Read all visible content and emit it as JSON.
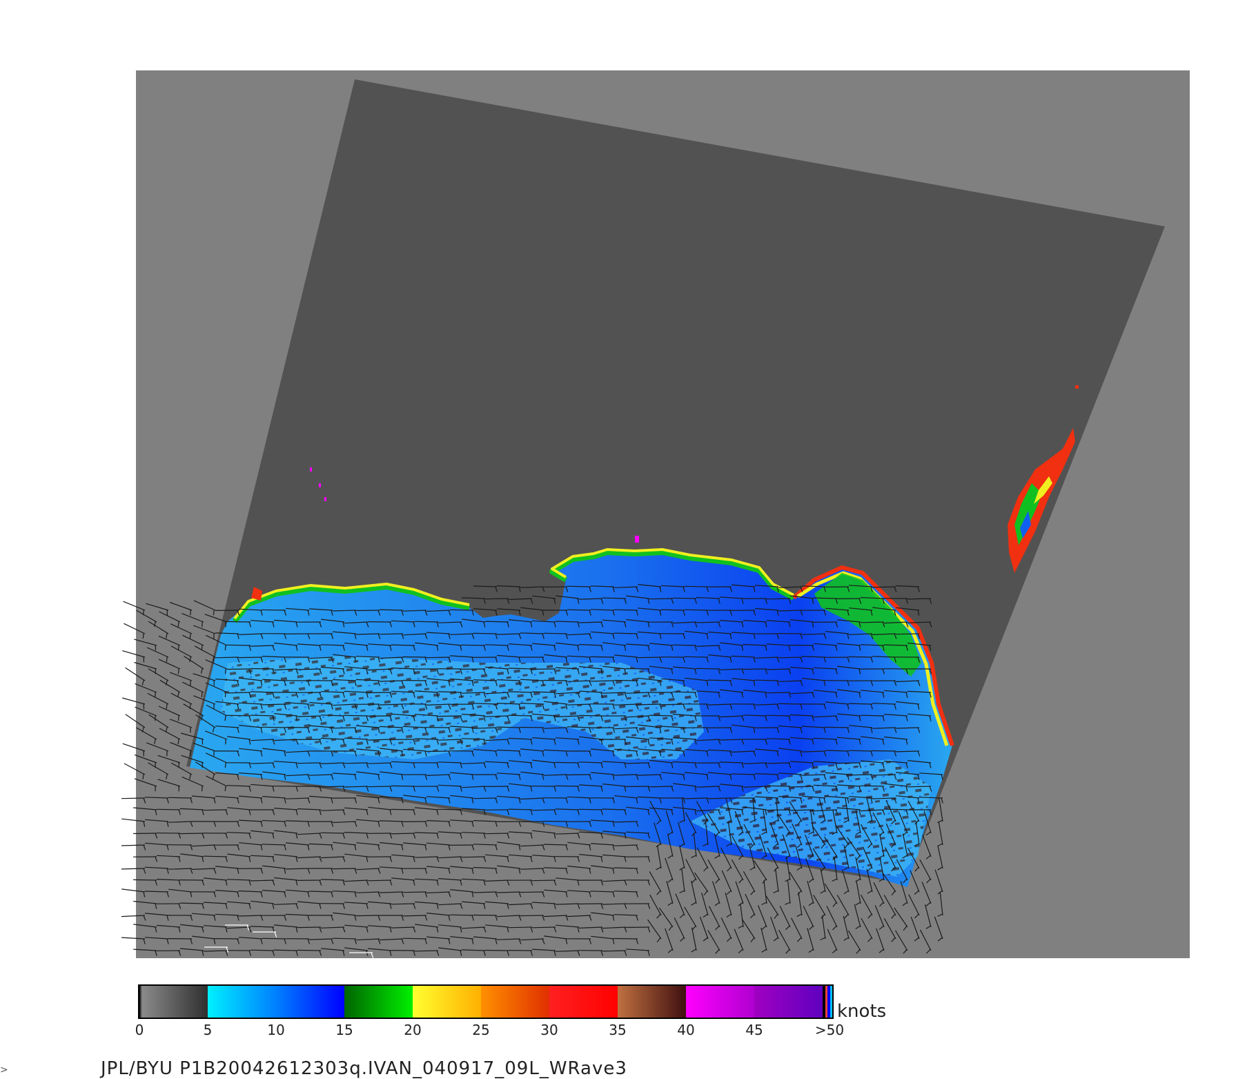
{
  "caption": "JPL/BYU  P1B20042612303q.IVAN_040917_09L_WRave3",
  "colorbar": {
    "units": "knots",
    "tick_labels": [
      "0",
      "5",
      "10",
      "15",
      "20",
      "25",
      "30",
      "35",
      "40",
      "45",
      ">50"
    ],
    "segments": [
      {
        "from": "#000000",
        "to": "#8a8a8a",
        "to2": "#2f2f2f"
      },
      {
        "from": "#00f0ff",
        "to": "#0080ff"
      },
      {
        "from": "#0080ff",
        "to": "#0000ff"
      },
      {
        "from": "#006400",
        "to": "#00f000"
      },
      {
        "from": "#ffff30",
        "to": "#ffb000"
      },
      {
        "from": "#ff9000",
        "to": "#e03000"
      },
      {
        "from": "#ff2020",
        "to": "#ff0000"
      },
      {
        "from": "#c07040",
        "to": "#401010"
      },
      {
        "from": "#ff00ff",
        "to": "#b000d0"
      },
      {
        "from": "#a000c0",
        "to": "#6000c0"
      }
    ],
    "tail_colors": [
      "#000000",
      "#ff4040",
      "#0000ff",
      "#00c0ff"
    ]
  },
  "map_colors": {
    "frame": "#808080",
    "swath": "#525252",
    "low_wind": "#2aa8f0",
    "mid_wind": "#1060f0",
    "green": "#10c020",
    "yellow": "#f0f020",
    "red": "#f03010",
    "dark_patch": "#3a3a3a"
  }
}
